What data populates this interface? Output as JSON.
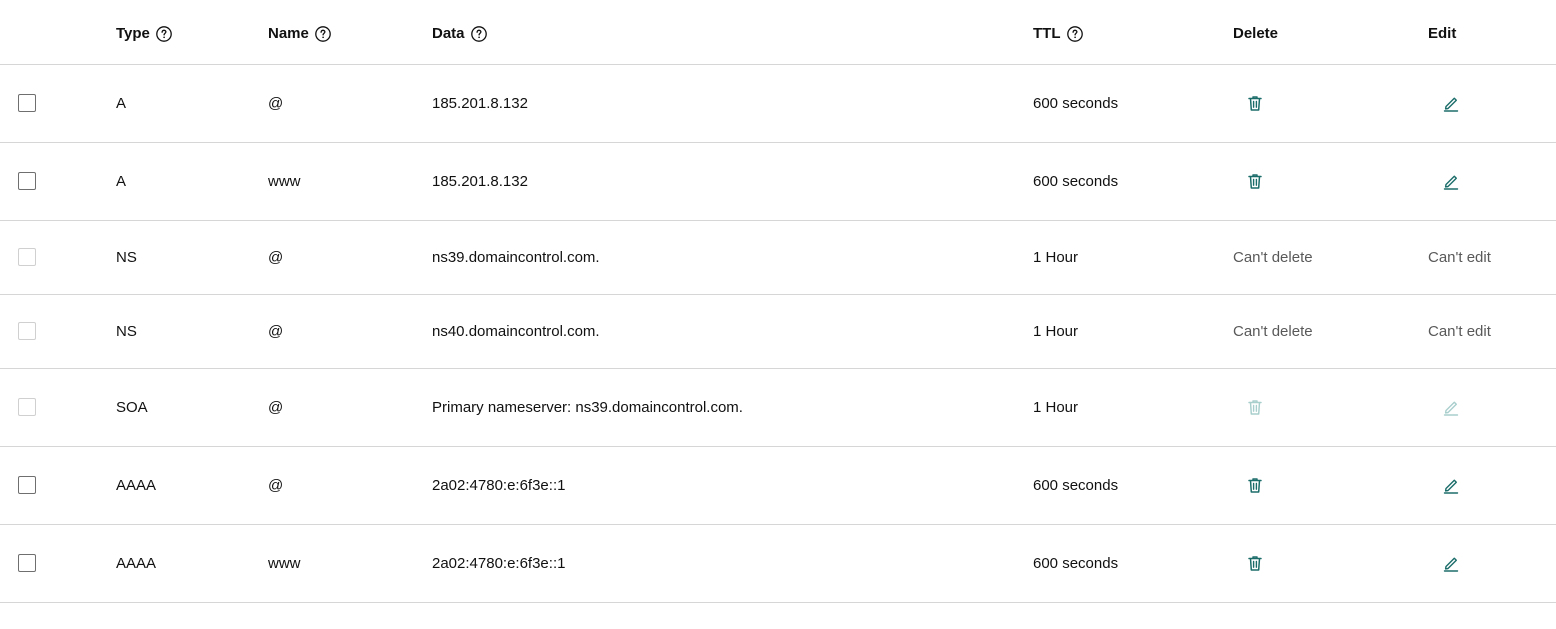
{
  "header": {
    "type": "Type",
    "name": "Name",
    "data": "Data",
    "ttl": "TTL",
    "delete": "Delete",
    "edit": "Edit"
  },
  "icons": {
    "help": "help-circle-icon",
    "delete": "trash-icon",
    "edit": "pencil-icon"
  },
  "colors": {
    "accent": "#1b6d6a",
    "accent_disabled": "#a9cfcd",
    "divider": "#d6d6d6"
  },
  "rows": [
    {
      "type": "A",
      "name": "@",
      "data": "185.201.8.132",
      "ttl": "600 seconds",
      "delete_state": "enabled",
      "edit_state": "enabled",
      "delete_text": "",
      "edit_text": ""
    },
    {
      "type": "A",
      "name": "www",
      "data": "185.201.8.132",
      "ttl": "600 seconds",
      "delete_state": "enabled",
      "edit_state": "enabled",
      "delete_text": "",
      "edit_text": ""
    },
    {
      "type": "NS",
      "name": "@",
      "data": "ns39.domaincontrol.com.",
      "ttl": "1 Hour",
      "delete_state": "text",
      "edit_state": "text",
      "delete_text": "Can't delete",
      "edit_text": "Can't edit"
    },
    {
      "type": "NS",
      "name": "@",
      "data": "ns40.domaincontrol.com.",
      "ttl": "1 Hour",
      "delete_state": "text",
      "edit_state": "text",
      "delete_text": "Can't delete",
      "edit_text": "Can't edit"
    },
    {
      "type": "SOA",
      "name": "@",
      "data": "Primary nameserver: ns39.domaincontrol.com.",
      "ttl": "1 Hour",
      "delete_state": "disabled",
      "edit_state": "disabled",
      "delete_text": "",
      "edit_text": ""
    },
    {
      "type": "AAAA",
      "name": "@",
      "data": "2a02:4780:e:6f3e::1",
      "ttl": "600 seconds",
      "delete_state": "enabled",
      "edit_state": "enabled",
      "delete_text": "",
      "edit_text": ""
    },
    {
      "type": "AAAA",
      "name": "www",
      "data": "2a02:4780:e:6f3e::1",
      "ttl": "600 seconds",
      "delete_state": "enabled",
      "edit_state": "enabled",
      "delete_text": "",
      "edit_text": ""
    }
  ]
}
